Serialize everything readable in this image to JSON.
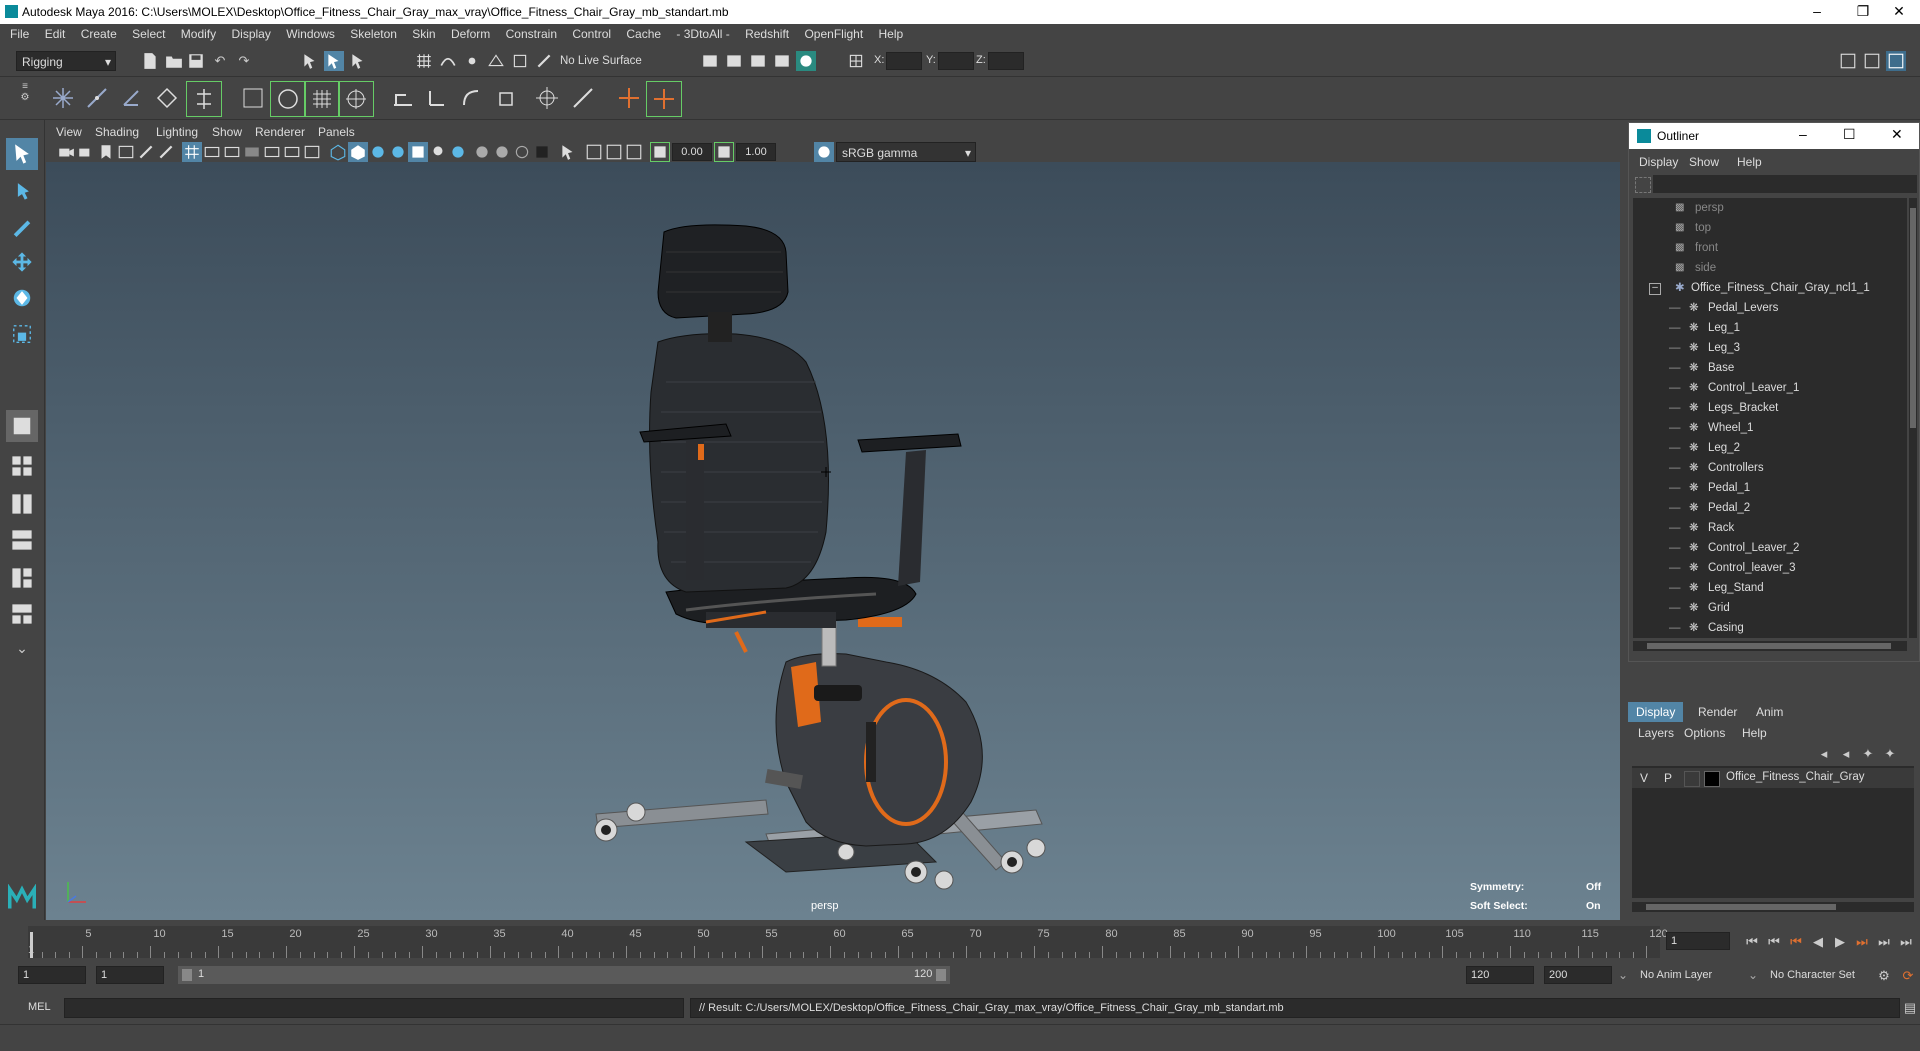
{
  "title": "Autodesk Maya 2016: C:\\Users\\MOLEX\\Desktop\\Office_Fitness_Chair_Gray_max_vray\\Office_Fitness_Chair_Gray_mb_standart.mb",
  "menu": [
    "File",
    "Edit",
    "Create",
    "Select",
    "Modify",
    "Display",
    "Windows",
    "Skeleton",
    "Skin",
    "Deform",
    "Constrain",
    "Control",
    "Cache",
    "- 3DtoAll -",
    "Redshift",
    "OpenFlight",
    "Help"
  ],
  "status": {
    "mode": "Rigging",
    "live_surface": "No Live Surface",
    "x_label": "X:",
    "y_label": "Y:",
    "z_label": "Z:"
  },
  "viewport": {
    "menu": [
      "View",
      "Shading",
      "Lighting",
      "Show",
      "Renderer",
      "Panels"
    ],
    "exposure": "0.00",
    "gamma": "1.00",
    "colorspace": "sRGB gamma",
    "camera_label": "persp",
    "symmetry_label": "Symmetry:",
    "symmetry_value": "Off",
    "soft_select_label": "Soft Select:",
    "soft_select_value": "On"
  },
  "outliner": {
    "title": "Outliner",
    "menu": [
      "Display",
      "Show",
      "Help"
    ],
    "cameras": [
      "persp",
      "top",
      "front",
      "side"
    ],
    "group": "Office_Fitness_Chair_Gray_ncl1_1",
    "children": [
      "Pedal_Levers",
      "Leg_1",
      "Leg_3",
      "Base",
      "Control_Leaver_1",
      "Legs_Bracket",
      "Wheel_1",
      "Leg_2",
      "Controllers",
      "Pedal_1",
      "Pedal_2",
      "Rack",
      "Control_Leaver_2",
      "Control_leaver_3",
      "Leg_Stand",
      "Grid",
      "Casing"
    ]
  },
  "layers": {
    "tabs": [
      "Display",
      "Render",
      "Anim"
    ],
    "menu": [
      "Layers",
      "Options",
      "Help"
    ],
    "layer": {
      "v": "V",
      "p": "P",
      "name": "Office_Fitness_Chair_Gray"
    }
  },
  "timeline": {
    "ticks": [
      "5",
      "10",
      "15",
      "20",
      "25",
      "30",
      "35",
      "40",
      "45",
      "50",
      "55",
      "60",
      "65",
      "70",
      "75",
      "80",
      "85",
      "90",
      "95",
      "100",
      "105",
      "110",
      "115",
      "120"
    ],
    "start_label": "1",
    "current_frame": "1"
  },
  "range": {
    "start": "1",
    "inner_start": "1",
    "slider_start": "1",
    "slider_end": "120",
    "end": "120",
    "max": "200",
    "anim_layer": "No Anim Layer",
    "char_set": "No Character Set"
  },
  "cmd": {
    "lang": "MEL",
    "result": "// Result: C:/Users/MOLEX/Desktop/Office_Fitness_Chair_Gray_max_vray/Office_Fitness_Chair_Gray_mb_standart.mb"
  }
}
